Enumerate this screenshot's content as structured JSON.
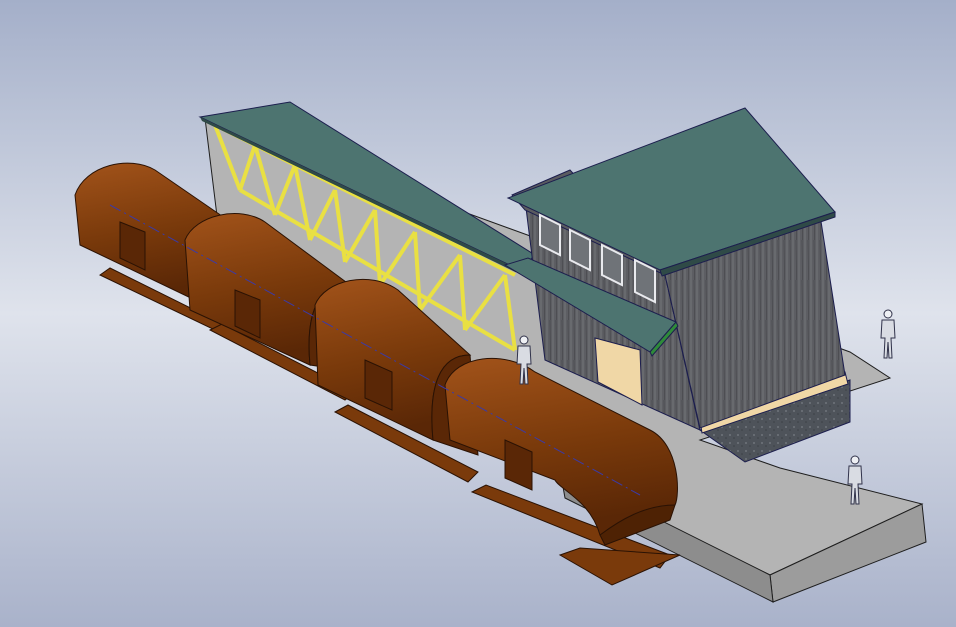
{
  "viewport": {
    "background_top": "#a4afc9",
    "background_mid": "#dfe3ec",
    "background_bottom": "#a9b2ca"
  },
  "colors": {
    "platform_top": "#b4b4b4",
    "platform_side": "#8f8f8f",
    "roof": "#4d7470",
    "wall": "#5f6065",
    "truss": "#e9e043",
    "wagon": "#7a3a0b",
    "wagon_dark": "#4e2204",
    "floor": "#f0d7a6",
    "base": "#53585e",
    "edge": "#1c1e4e",
    "axis_line": "#3a3aa8"
  },
  "figures": [
    {
      "icon": "person-icon"
    },
    {
      "icon": "person-icon"
    },
    {
      "icon": "person-icon"
    }
  ]
}
